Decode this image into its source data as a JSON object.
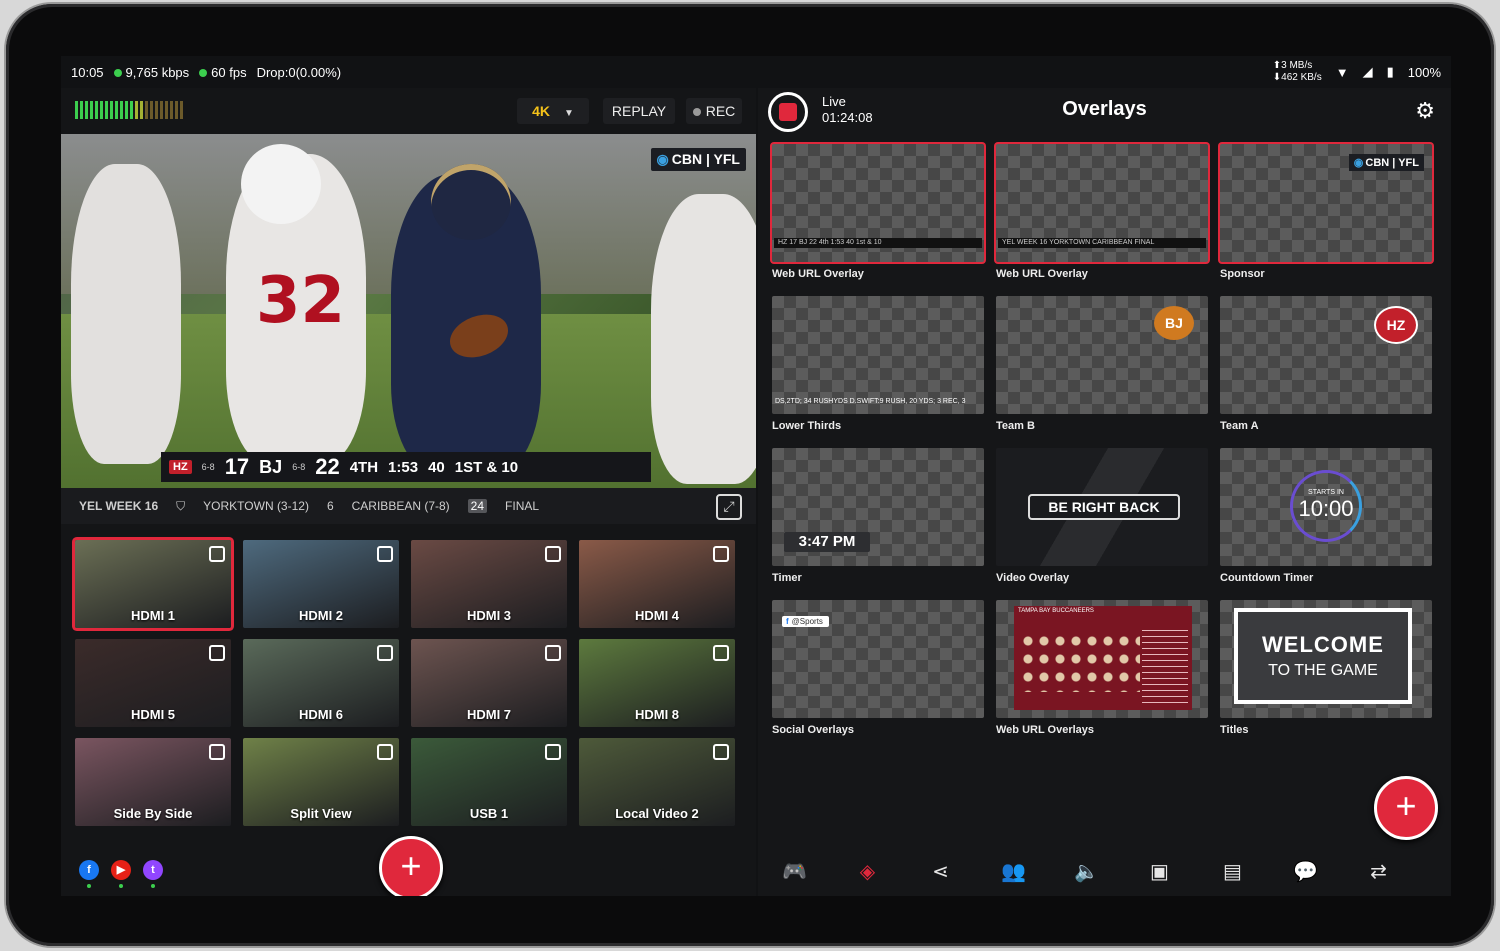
{
  "status": {
    "time": "10:05",
    "bitrate": "9,765 kbps",
    "fps": "60 fps",
    "drop": "Drop:0(0.00%)",
    "net_up": "⬆3 MB/s",
    "net_down": "⬇462 KB/s",
    "battery": "100%"
  },
  "toolbar": {
    "quality": "4K",
    "replay": "REPLAY",
    "rec": "REC"
  },
  "program": {
    "bug_cbn": "CBN",
    "bug_yfl": "YFL",
    "jersey": "32",
    "score": {
      "team_a": "HZ",
      "team_a_record": "6-8",
      "team_a_score": "17",
      "team_b": "BJ",
      "team_b_record": "6-8",
      "team_b_score": "22",
      "quarter": "4TH",
      "clock": "1:53",
      "play_clock": "40",
      "down": "1ST & 10"
    },
    "ticker": {
      "week": "YEL WEEK 16",
      "team1": "YORKTOWN (3-12)",
      "team1_score": "6",
      "team2": "CARIBBEAN (7-8)",
      "team2_score": "24",
      "status": "FINAL"
    }
  },
  "sources": [
    {
      "label": "HDMI 1",
      "bg": "#6b6f55"
    },
    {
      "label": "HDMI 2",
      "bg": "#4e6a7e"
    },
    {
      "label": "HDMI 3",
      "bg": "#6a4a44"
    },
    {
      "label": "HDMI 4",
      "bg": "#8a5a48"
    },
    {
      "label": "HDMI 5",
      "bg": "#3b2b2a"
    },
    {
      "label": "HDMI 6",
      "bg": "#5a6a5a"
    },
    {
      "label": "HDMI 7",
      "bg": "#6d5450"
    },
    {
      "label": "HDMI 8",
      "bg": "#5d7a3e"
    },
    {
      "label": "Side By Side",
      "bg": "#7a5560"
    },
    {
      "label": "Split View",
      "bg": "#6f8148"
    },
    {
      "label": "USB 1",
      "bg": "#3b5a3a"
    },
    {
      "label": "Local Video 2",
      "bg": "#4e5a3a"
    }
  ],
  "live": {
    "label": "Live",
    "duration": "01:24:08"
  },
  "overlays_title": "Overlays",
  "overlays": [
    {
      "label": "Web URL Overlay",
      "strip": "HZ 17 BJ 22 4th 1:53 40 1st & 10"
    },
    {
      "label": "Web URL Overlay",
      "strip": "YEL WEEK 16  YORKTOWN  CARIBBEAN  FINAL"
    },
    {
      "label": "Sponsor",
      "bug_cbn": "CBN",
      "bug_yfl": "YFL"
    },
    {
      "label": "Lower Thirds",
      "text": "DS,2TD; 34 RUSHYDS D.SWIFT:9 RUSH, 20 YDS; 3 REC, 3"
    },
    {
      "label": "Team B",
      "logo": "BJ"
    },
    {
      "label": "Team A",
      "logo": "HZ"
    },
    {
      "label": "Timer",
      "time": "3:47 PM"
    },
    {
      "label": "Video Overlay",
      "text": "BE RIGHT BACK"
    },
    {
      "label": "Countdown Timer",
      "starts": "STARTS IN",
      "time": "10:00"
    },
    {
      "label": "Social Overlays",
      "handle": "@Sports"
    },
    {
      "label": "Web URL Overlays",
      "title": "TAMPA BAY BUCCANEERS"
    },
    {
      "label": "Titles",
      "line1": "WELCOME",
      "line2": "TO THE GAME"
    }
  ],
  "colors": {
    "accent": "#e0283c",
    "live_green": "#3ccf4e",
    "quality": "#f6c31a"
  },
  "icons": {
    "fab": "+",
    "social": [
      "facebook-icon",
      "youtube-icon",
      "twitch-icon"
    ],
    "nav": [
      "gamepad-icon",
      "layers-icon",
      "share-icon",
      "users-icon",
      "audio-icon",
      "aspect-ratio-icon",
      "replay-icon",
      "comments-icon",
      "switch-camera-icon"
    ]
  }
}
